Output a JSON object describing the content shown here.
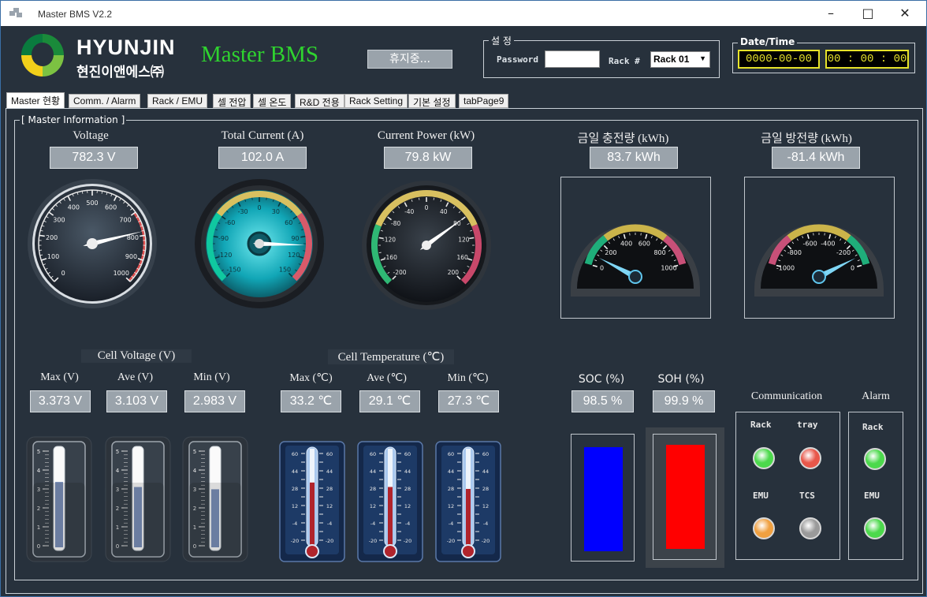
{
  "window": {
    "title": "Master BMS V2.2",
    "icon": "app-window-icon",
    "controls": [
      "minimize",
      "maximize",
      "close"
    ]
  },
  "header": {
    "brand_name": "HYUNJIN",
    "brand_sub": "현진이앤에스㈜",
    "app_title": "Master BMS",
    "status_button": "휴지중...",
    "settings": {
      "group_title": "설 정",
      "password_label": "Password",
      "password_value": "",
      "rack_label": "Rack #",
      "rack_selected": "Rack 01"
    },
    "datetime": {
      "group_title": "Date/Time",
      "date": "0000-00-00",
      "time": "00 : 00 : 00"
    }
  },
  "tabs": [
    "Master 현황",
    "Comm. / Alarm",
    "Rack / EMU",
    "셀 전압",
    "셀 온도",
    "R&D 전용",
    "Rack Setting",
    "기본 설정",
    "tabPage9"
  ],
  "active_tab": "Master 현황",
  "master": {
    "group_title": "[ Master Information ]",
    "voltage": {
      "label": "Voltage",
      "value": "782.3 V",
      "reading": 782.3,
      "scale_min": 0,
      "scale_max": 1000,
      "ticks": [
        "0",
        "100",
        "200",
        "300",
        "400",
        "500",
        "600",
        "700",
        "800",
        "900",
        "1000"
      ]
    },
    "current": {
      "label": "Total Current (A)",
      "value": "102.0 A",
      "reading": 102.0,
      "scale_min": -150,
      "scale_max": 150,
      "ticks": [
        "-150",
        "-120",
        "-90",
        "-60",
        "-30",
        "0",
        "30",
        "60",
        "90",
        "120",
        "150"
      ]
    },
    "power": {
      "label": "Current Power (kW)",
      "value": "79.8 kW",
      "reading": 79.8,
      "scale_min": -200,
      "scale_max": 200,
      "ticks": [
        "-200",
        "-160",
        "-120",
        "-80",
        "-40",
        "0",
        "40",
        "80",
        "120",
        "160",
        "200"
      ]
    },
    "charge": {
      "label": "금일 충전량 (kWh)",
      "value": "83.7 kWh",
      "reading": 83.7,
      "scale_min": 0,
      "scale_max": 1000,
      "ticks": [
        "0",
        "200",
        "400",
        "600",
        "800",
        "1000"
      ]
    },
    "discharge": {
      "label": "금일 방전량 (kWh)",
      "value": "-81.4 kWh",
      "reading": -81.4,
      "scale_min": -1000,
      "scale_max": 0,
      "ticks": [
        "-1000",
        "-800",
        "-600",
        "-400",
        "-200",
        "0"
      ]
    }
  },
  "cell_voltage": {
    "title": "Cell Voltage (V)",
    "scale_ticks": [
      "0",
      "1",
      "2",
      "3",
      "4",
      "5"
    ],
    "scale_max": 5,
    "items": [
      {
        "label": "Max (V)",
        "value": "3.373 V",
        "reading": 3.373
      },
      {
        "label": "Ave (V)",
        "value": "3.103 V",
        "reading": 3.103
      },
      {
        "label": "Min (V)",
        "value": "2.983 V",
        "reading": 2.983
      }
    ]
  },
  "cell_temp": {
    "title": "Cell Temperature (℃)",
    "scale_ticks": [
      "-20",
      "-12",
      "-4",
      "4",
      "12",
      "20",
      "28",
      "36",
      "44",
      "52",
      "60"
    ],
    "scale_min": -20,
    "scale_max": 60,
    "items": [
      {
        "label": "Max (℃)",
        "value": "33.2 ℃",
        "reading": 33.2
      },
      {
        "label": "Ave (℃)",
        "value": "29.1 ℃",
        "reading": 29.1
      },
      {
        "label": "Min (℃)",
        "value": "27.3 ℃",
        "reading": 27.3
      }
    ]
  },
  "soc": {
    "label": "SOC (%)",
    "value": "98.5 %",
    "reading": 98.5,
    "color": "#0000ff"
  },
  "soh": {
    "label": "SOH (%)",
    "value": "99.9 %",
    "reading": 99.9,
    "color": "#ff0000"
  },
  "communication": {
    "title": "Communication",
    "leds": [
      {
        "label": "Rack",
        "color": "#4cd94c"
      },
      {
        "label": "tray",
        "color": "#e8574a"
      },
      {
        "label": "EMU",
        "color": "#f0a040"
      },
      {
        "label": "TCS",
        "color": "#9a9a9a"
      }
    ]
  },
  "alarm": {
    "title": "Alarm",
    "leds": [
      {
        "label": "Rack",
        "color": "#4cd94c"
      },
      {
        "label": "EMU",
        "color": "#4cd94c"
      }
    ]
  },
  "colors": {
    "background": "#27313c",
    "accent_green": "#2fd32f",
    "value_box": "#9aa3ab",
    "datetime": "#e7e32a"
  }
}
